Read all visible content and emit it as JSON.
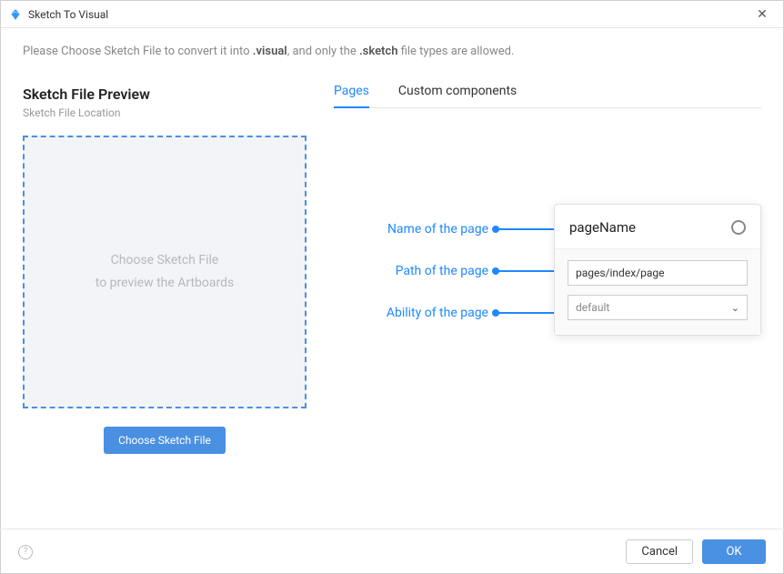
{
  "window": {
    "title": "Sketch To Visual"
  },
  "instruction": {
    "prefix": "Please Choose Sketch File to convert it into ",
    "strong1": ".visual",
    "mid": ", and only the ",
    "strong2": ".sketch",
    "suffix": " file types are allowed."
  },
  "preview": {
    "title": "Sketch File Preview",
    "subtitle": "Sketch File Location",
    "dropzone_line1": "Choose Sketch File",
    "dropzone_line2": "to preview the Artboards",
    "button": "Choose Sketch File"
  },
  "tabs": {
    "pages": "Pages",
    "custom": "Custom components"
  },
  "labels": {
    "name": "Name of the page",
    "path": "Path of the page",
    "ability": "Ability of the page"
  },
  "popover": {
    "title": "pageName",
    "path_value": "pages/index/page",
    "ability_value": "default"
  },
  "footer": {
    "cancel": "Cancel",
    "ok": "OK"
  }
}
